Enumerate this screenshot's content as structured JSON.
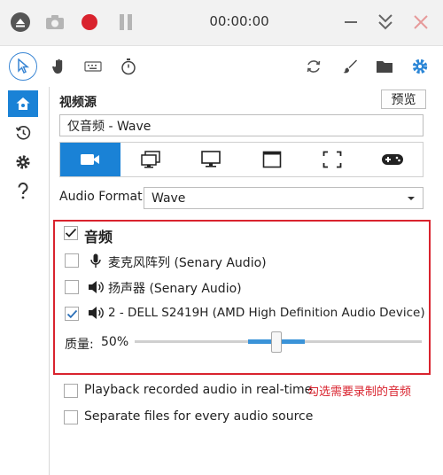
{
  "titlebar": {
    "timer": "00:00:00",
    "icons": [
      "eject-icon",
      "camera-icon",
      "record-icon",
      "pause-icon",
      "minimize-icon",
      "collapse-icon",
      "close-icon"
    ]
  },
  "toolbar": {
    "icons": [
      "pointer-icon",
      "hand-icon",
      "keyboard-icon",
      "stopwatch-icon",
      "refresh-icon",
      "brush-icon",
      "folder-icon",
      "settings-icon"
    ]
  },
  "sidebar": {
    "icons": [
      "home-icon",
      "history-icon",
      "gear-icon",
      "help-icon"
    ]
  },
  "video_source": {
    "label": "视频源",
    "preview_button": "预览",
    "current_value": "仅音频 - Wave"
  },
  "source_modes": [
    "camera-icon",
    "window-icon",
    "screen-icon",
    "region-window-icon",
    "fullscreen-icon",
    "game-icon"
  ],
  "audio_format": {
    "label": "Audio Format",
    "value": "Wave"
  },
  "audio": {
    "heading": "音频",
    "checked": true,
    "devices": [
      {
        "name": "麦克风阵列 (Senary Audio)",
        "checked": false,
        "icon": "microphone-icon"
      },
      {
        "name": "扬声器 (Senary Audio)",
        "checked": false,
        "icon": "speaker-icon"
      },
      {
        "name": "2 - DELL S2419H (AMD High Definition Audio Device)",
        "checked": true,
        "icon": "speaker-icon"
      }
    ],
    "quality_label": "质量:",
    "quality_value": "50%",
    "quality_level": 0.5
  },
  "options": [
    {
      "label": "Playback recorded audio in real-time",
      "checked": false
    },
    {
      "label": "Separate files for every audio source",
      "checked": false
    }
  ],
  "annotation": "勾选需要录制的音频",
  "colors": {
    "accent": "#1a82d6",
    "highlight": "#d9232e",
    "record": "#d9232e"
  }
}
